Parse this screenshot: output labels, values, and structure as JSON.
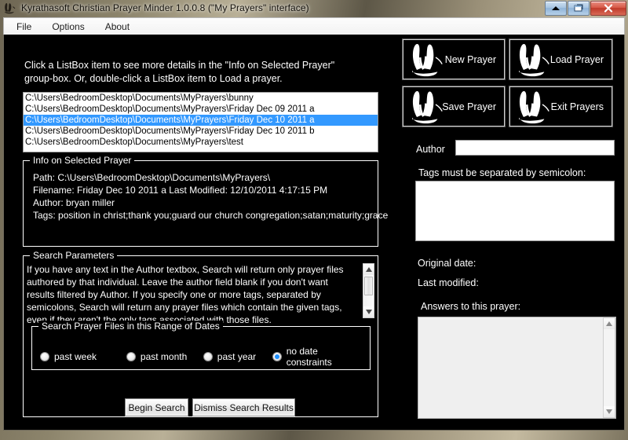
{
  "window": {
    "title": "Kyrathasoft Christian Prayer Minder 1.0.0.8 (\"My Prayers\" interface)",
    "icon": "praying-hands-icon",
    "controls": {
      "minimize": "▲",
      "restore": "❐",
      "close": "✕"
    }
  },
  "menubar": {
    "items": [
      {
        "label": "File"
      },
      {
        "label": "Options"
      },
      {
        "label": "About"
      }
    ]
  },
  "hint": {
    "line1": "Click a ListBox item to see more details in the \"Info on Selected Prayer\"",
    "line2": "group-box. Or, double-click a ListBox item to Load a prayer."
  },
  "listbox": {
    "items": [
      {
        "text": "C:\\Users\\BedroomDesktop\\Documents\\MyPrayers\\bunny",
        "selected": false
      },
      {
        "text": "C:\\Users\\BedroomDesktop\\Documents\\MyPrayers\\Friday Dec 09 2011 a",
        "selected": false
      },
      {
        "text": "C:\\Users\\BedroomDesktop\\Documents\\MyPrayers\\Friday Dec 10 2011 a",
        "selected": true
      },
      {
        "text": "C:\\Users\\BedroomDesktop\\Documents\\MyPrayers\\Friday Dec 10 2011 b",
        "selected": false
      },
      {
        "text": "C:\\Users\\BedroomDesktop\\Documents\\MyPrayers\\test",
        "selected": false
      }
    ]
  },
  "info_group": {
    "title": "Info on Selected Prayer",
    "path": "Path: C:\\Users\\BedroomDesktop\\Documents\\MyPrayers\\",
    "filename_and_modified": "Filename: Friday Dec 10 2011 a   Last Modified: 12/10/2011 4:17:15 PM",
    "author": "Author: bryan miller",
    "tags": "Tags:  position in christ;thank you;guard our church congregation;satan;maturity;grace"
  },
  "search_group": {
    "title": "Search Parameters",
    "description": "If you have any text in the Author textbox, Search will return only prayer files authored by that individual. Leave the author field blank if you don't want results filtered by Author. If you specify one or more tags, separated by semicolons, Search will return any prayer files which contain the given tags, even if they aren't the only tags associated with those files.",
    "date_range": {
      "title": "Search Prayer Files in this Range of Dates",
      "options": [
        {
          "label": "past week",
          "checked": false
        },
        {
          "label": "past month",
          "checked": false
        },
        {
          "label": "past year",
          "checked": false
        },
        {
          "label": "no date constraints",
          "checked": true
        }
      ]
    }
  },
  "buttons": {
    "begin_search": "Begin Search",
    "dismiss_results": "Dismiss Search Results"
  },
  "right_panel": {
    "actions": [
      {
        "label": "New Prayer",
        "icon": "praying-hands-icon"
      },
      {
        "label": "Load Prayer",
        "icon": "praying-hands-icon"
      },
      {
        "label": "Save Prayer",
        "icon": "praying-hands-icon"
      },
      {
        "label": "Exit Prayers",
        "icon": "praying-hands-icon"
      }
    ],
    "author_label": "Author",
    "author_value": "",
    "tags_label": "Tags must be separated by semicolon:",
    "tags_value": "",
    "original_date_label": "Original date:",
    "last_modified_label": "Last modified:",
    "answers_label": "Answers to this prayer:",
    "answers_value": ""
  },
  "colors": {
    "client_background": "#000000",
    "text": "#ffffff",
    "selection": "#3399ff",
    "radio_accent": "#1e90ff",
    "field_background": "#ffffff",
    "disabled_field_background": "#efefef"
  }
}
